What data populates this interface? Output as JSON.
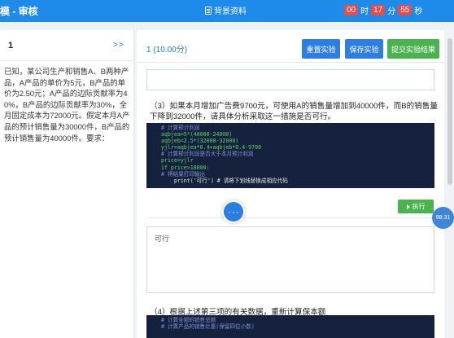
{
  "header": {
    "title": "模 - 审核",
    "bg_label": "背景资料",
    "timer": {
      "hours": "00",
      "h_unit": "时",
      "minutes": "17",
      "m_unit": "分",
      "seconds": "55",
      "s_unit": "秒"
    }
  },
  "left": {
    "question_number": "1",
    "next_label": ">>",
    "text": "已知，某公司生产和销售A、B两种产品，A产品的单价为5元，B产品的单价为2.50元；A产品的边际贡献率为40%，B产品的边际贡献率为30%，全月固定成本为72000元。假定本月A产品的预计销售量为30000件，B产品的预计销售量为40000件。要求："
  },
  "main": {
    "score": "1 (10.00分)",
    "buttons": {
      "reset": "重置实验",
      "save": "保存实验",
      "submit": "提交实验结果"
    },
    "q3": "（3）如果本月增加广告费9700元，可使用A的销售量增加到40000件，而B的销售量下降到32000件，请具体分析采取这一措施是否可行。",
    "code_lines": [
      {
        "text": "# 计算预计利润",
        "cls": "c"
      },
      {
        "text": "aqbjea=5*(40000-24000)",
        "cls": "n"
      },
      {
        "text": "aqbjeb=2.5*(32000-32000)",
        "cls": "n"
      },
      {
        "text": "yjlr=aqbjea*0.4+aqbjeb*0.4-9700",
        "cls": "n"
      },
      {
        "text": "# 计算预计利润是否大于本月预计利润",
        "cls": "c"
      },
      {
        "text": "price=yjlr",
        "cls": "n"
      },
      {
        "text": "if price>18000:",
        "cls": "n"
      },
      {
        "text": "# 将结果打印输出",
        "cls": "c"
      },
      {
        "text": "    print('可行') # 请将下划线替换成相应代码",
        "cls": "w"
      }
    ],
    "run_label": "执行",
    "answer": "可行",
    "q4": "（4）根据上述第三项的有关数据，重新计算保本额",
    "code2_lines": [
      "# 计算全部的销售总额",
      "# 计算产品的销售比重(保留四位小数)"
    ]
  },
  "overlay": {
    "center": "- - -",
    "time": "98:31"
  }
}
